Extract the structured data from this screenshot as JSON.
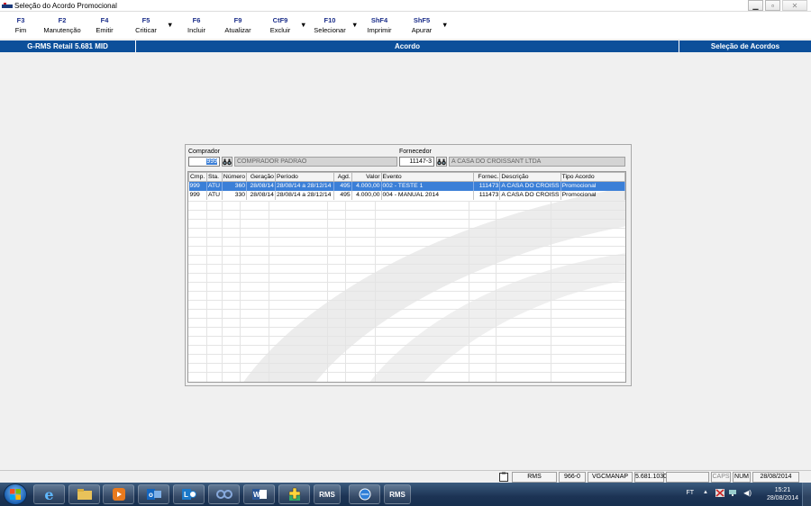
{
  "window": {
    "title": "Seleção do Acordo Promocional",
    "controls": [
      "minimize",
      "maximize",
      "close"
    ]
  },
  "toolbar": {
    "items": [
      {
        "key": "F3",
        "label": "Fim"
      },
      {
        "key": "F2",
        "label": "Manutenção"
      },
      {
        "key": "F4",
        "label": "Emitir"
      },
      {
        "key": "F5",
        "label": "Criticar"
      },
      {
        "key": "F6",
        "label": "Incluir"
      },
      {
        "key": "F9",
        "label": "Atualizar"
      },
      {
        "key": "CtF9",
        "label": "Excluir"
      },
      {
        "key": "F10",
        "label": "Selecionar"
      },
      {
        "key": "ShF4",
        "label": "Imprimir"
      },
      {
        "key": "ShF5",
        "label": "Apurar"
      }
    ]
  },
  "header": {
    "left": "G-RMS Retail 5.681 MID",
    "center": "Acordo",
    "right": "Seleção de Acordos"
  },
  "form": {
    "comprador_label": "Comprador",
    "comprador_code": "999",
    "comprador_name": "COMPRADOR PADRAO",
    "fornecedor_label": "Fornecedor",
    "fornecedor_code": "11147-3",
    "fornecedor_name": "A CASA DO CROISSANT LTDA"
  },
  "grid": {
    "columns": [
      "Cmp.",
      "Sta.",
      "Número",
      "Geração",
      "Período",
      "Agd.",
      "Valor",
      "Evento",
      "Fornec.",
      "Descrição",
      "Tipo Acordo"
    ],
    "rows": [
      {
        "cmp": "999",
        "sta": "ATU",
        "numero": "360",
        "geracao": "28/08/14",
        "periodo": "28/08/14 a 28/12/14",
        "agd": "495",
        "valor": "4.000,00",
        "evento": "002 -  TESTE 1",
        "fornec": "111473",
        "descricao": "A CASA DO CROISS",
        "tipo": "Promocional",
        "selected": true
      },
      {
        "cmp": "999",
        "sta": "ATU",
        "numero": "330",
        "geracao": "28/08/14",
        "periodo": "28/08/14 a 28/12/14",
        "agd": "495",
        "valor": "4.000,00",
        "evento": "004 -  MANUAL 2014",
        "fornec": "111473",
        "descricao": "A CASA DO CROISS",
        "tipo": "Promocional",
        "selected": false
      }
    ]
  },
  "statusbar": {
    "system": "RMS",
    "filial": "966-0",
    "user": "VGCMANAP",
    "version": "5.681.1030",
    "caps": "CAPS",
    "num": "NUM",
    "date": "28/08/2014"
  },
  "taskbar": {
    "apps": [
      "start-orb",
      "internet-explorer",
      "file-explorer",
      "media-player",
      "outlook",
      "lync",
      "teamviewer",
      "word",
      "rms-tool",
      "rms",
      "ie-app",
      "rms-2"
    ],
    "rms_label": "RMS",
    "language": "FT",
    "time": "15:21",
    "date": "28/08/2014"
  },
  "colors": {
    "header_blue": "#0c4f9a",
    "toolbar_key": "#1c2f8a",
    "selection": "#3b7fd7"
  }
}
